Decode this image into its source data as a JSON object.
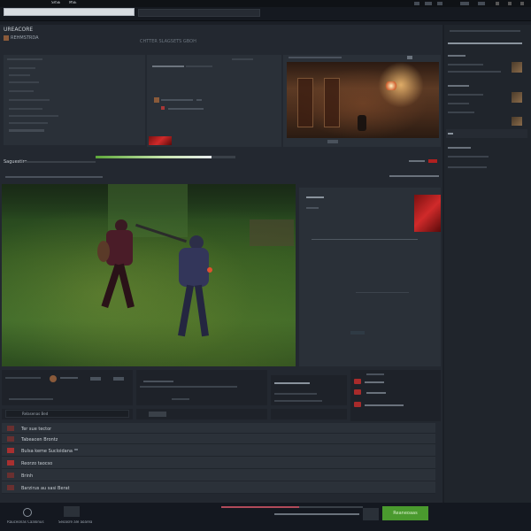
{
  "topbar": {
    "menu": [
      "SRSE",
      "MSE"
    ],
    "right_items": [
      "",
      "",
      "",
      "",
      "",
      "",
      "",
      ""
    ]
  },
  "search": {
    "value": "",
    "placeholder": ""
  },
  "library": {
    "title": "UREACORE",
    "subtitle": "REHMSTRDA",
    "heading": "CHTTER SLAGSETS GBOH",
    "sidebar_lines": [
      "",
      "",
      "",
      "",
      "",
      "",
      "",
      "",
      "",
      "",
      "",
      "",
      ""
    ]
  },
  "mid_panel": {
    "lines": [
      "",
      ""
    ]
  },
  "room": {
    "label": ""
  },
  "status_row": {
    "label": "Saguestire",
    "progress": 0.83,
    "right_label": "",
    "badge": ""
  },
  "stream_bar": {
    "left_text": "",
    "right_text": ""
  },
  "info_panel": {
    "title": "",
    "lines": [
      "",
      ""
    ]
  },
  "bottom_panels": {
    "a_lines": [
      "",
      ""
    ],
    "b_lines": [
      "",
      ""
    ],
    "c_lines": [
      "",
      "",
      ""
    ],
    "d_lines": [
      "",
      "",
      ""
    ]
  },
  "inputs": {
    "left_value": "Relasenas Bed",
    "mid_value": ""
  },
  "list": {
    "rows": [
      {
        "label": "Ter sue tector"
      },
      {
        "label": "Tabeacen Brontz"
      },
      {
        "label": "Bulsa keme Sucloidana"
      },
      {
        "label": "Reorzo taocso"
      },
      {
        "label": "Brinh"
      },
      {
        "label": "Barzirus au sasi Berat"
      }
    ]
  },
  "footer": {
    "left_label": "Rauceonas Caalonus",
    "mid_label": "Seoasre ale aoarea",
    "status_text": "",
    "button_label": "Reaneoaas",
    "progress": 0.55
  },
  "rightcol": {
    "header": "",
    "items": [
      {
        "title": "",
        "sub": ""
      },
      {
        "title": "",
        "sub": ""
      },
      {
        "title": "",
        "sub": ""
      }
    ],
    "section2": "",
    "lines": [
      "",
      "",
      ""
    ]
  },
  "colors": {
    "bg": "#1b1f26",
    "panel": "#2a3038",
    "accent_green": "#4a9a2e",
    "accent_red": "#b02020"
  }
}
